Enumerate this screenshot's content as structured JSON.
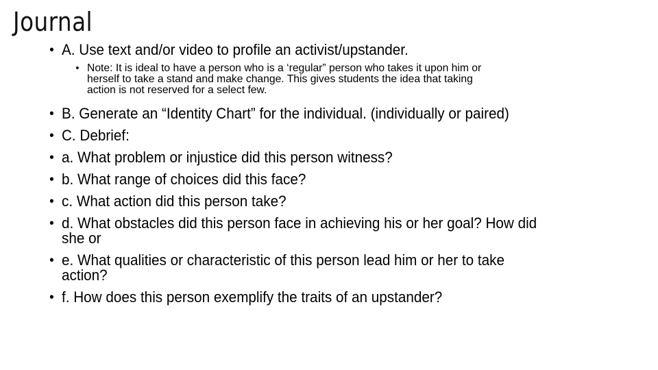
{
  "slide": {
    "title": "Journal",
    "bullets": [
      {
        "text": "A. Use text and/or video to profile an activist/upstander."
      },
      {
        "text": "B. Generate an “Identity Chart” for the individual. (individually or paired)"
      },
      {
        "text": "C. Debrief:"
      },
      {
        "text": "a. What problem or injustice did this person witness?"
      },
      {
        "text": "b. What range of choices did this face?"
      },
      {
        "text": "c. What action did this person take?"
      },
      {
        "text": "d. What obstacles did this person face in achieving his or her goal? How did",
        "continuation": "she or"
      },
      {
        "text": "e. What qualities or characteristic of this person lead him or her to take",
        "continuation": "action?"
      },
      {
        "text": "f. How does this person exemplify the traits of an upstander?"
      }
    ],
    "note": {
      "lines": [
        "Note: It is ideal to have a person who is a ‘regular” person who takes it upon him or",
        "herself to take a stand and make change. This gives students the idea that taking",
        "action is not reserved for a select few."
      ]
    },
    "bullet_glyph": "•"
  }
}
